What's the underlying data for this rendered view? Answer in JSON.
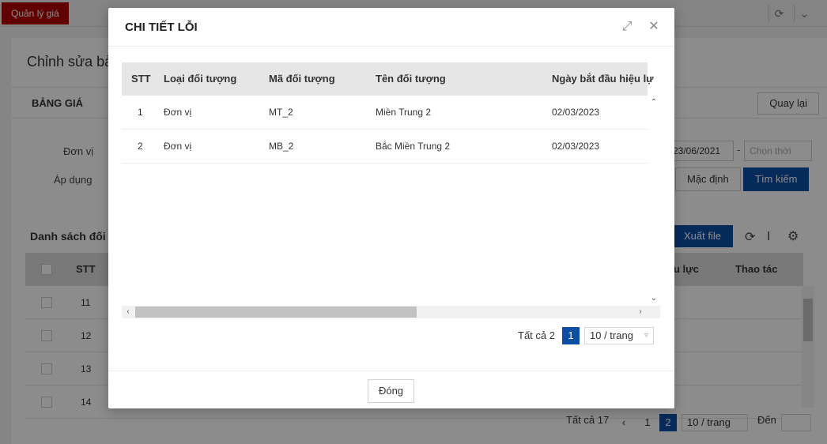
{
  "app": {
    "tab_label": "Quản lý giá",
    "refresh_icon": "refresh-icon",
    "collapse_icon": "chevron-down-icon"
  },
  "page": {
    "title": "Chỉnh sửa bả",
    "section_title": "BẢNG GIÁ",
    "back_button": "Quay lại",
    "unit_label": "Đơn vị",
    "apply_label": "Áp dụng",
    "date_from": "23/06/2021",
    "date_sep": "-",
    "date_to_placeholder": "Chọn thời",
    "default_button": "Mặc định",
    "search_button": "Tìm kiếm",
    "export_button": "Xuất file",
    "list_title": "Danh sách đối",
    "grid_headers": {
      "stt": "STT",
      "effective": "u lực",
      "actions": "Thao tác"
    },
    "rows": [
      "11",
      "12",
      "13",
      "14"
    ],
    "pager": {
      "total": "Tất cả 17",
      "pages": [
        "1",
        "2"
      ],
      "active_page": "2",
      "page_size": "10 / trang",
      "goto_label": "Đến"
    }
  },
  "modal": {
    "title": "CHI TIẾT LỖI",
    "headers": [
      "STT",
      "Loại đối tượng",
      "Mã đối tượng",
      "Tên đối tượng",
      "Ngày bắt đầu hiệu lự"
    ],
    "rows": [
      {
        "stt": "1",
        "type": "Đơn vị",
        "code": "MT_2",
        "name": "Miền Trung 2",
        "start_date": "02/03/2023"
      },
      {
        "stt": "2",
        "type": "Đơn vị",
        "code": "MB_2",
        "name": "Bắc Miền Trung 2",
        "start_date": "02/03/2023"
      }
    ],
    "pager": {
      "total": "Tất cả 2",
      "page": "1",
      "page_size": "10 / trang"
    },
    "close_button": "Đóng"
  }
}
